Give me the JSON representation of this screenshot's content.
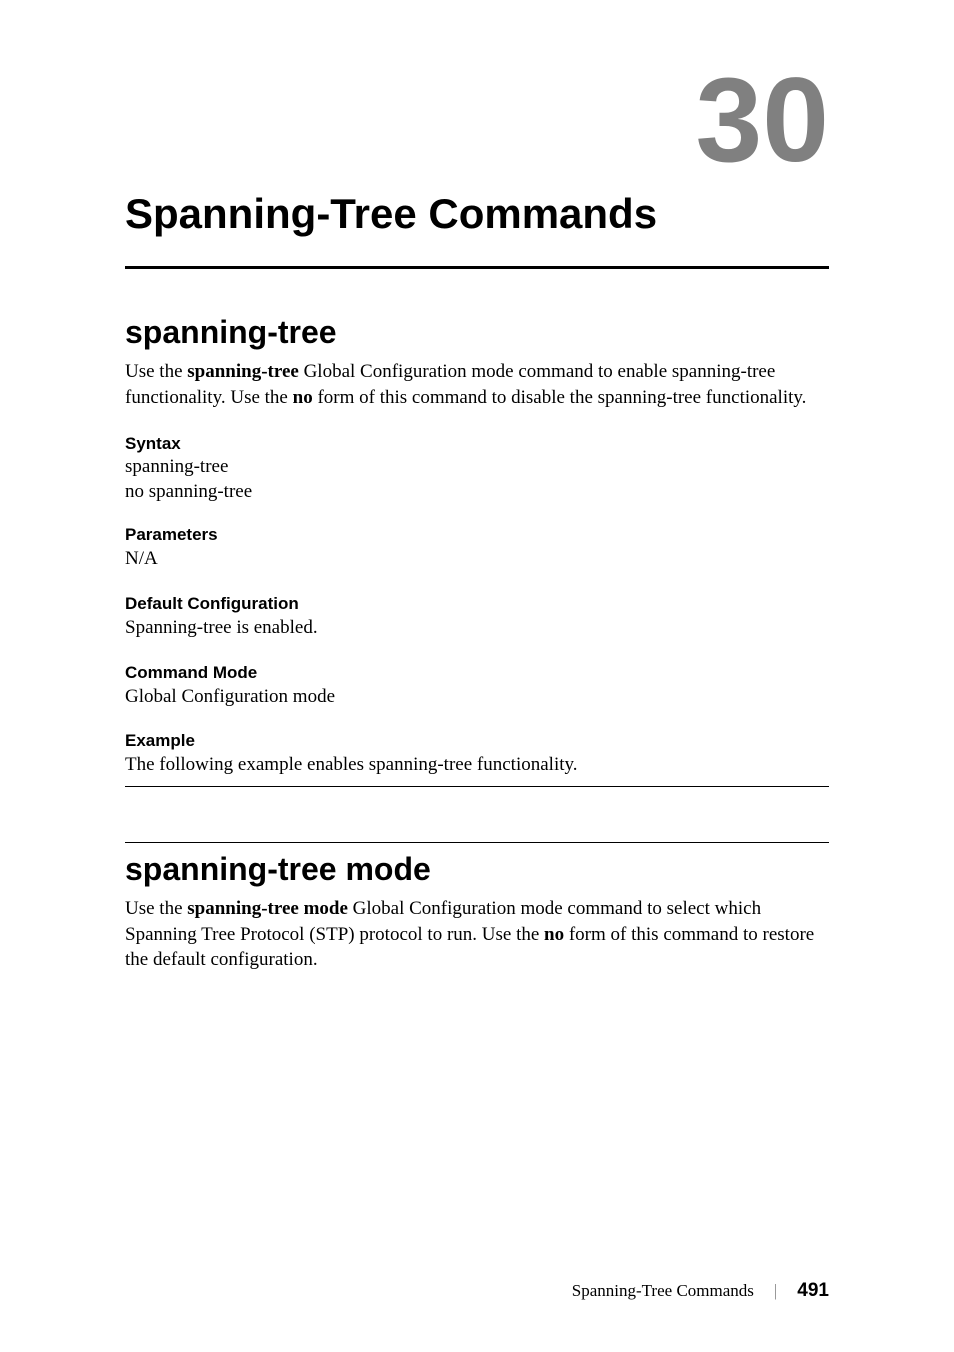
{
  "chapter_number": "30",
  "chapter_title": "Spanning-Tree Commands",
  "section1": {
    "title": "spanning-tree",
    "intro_pre": "Use the ",
    "intro_bold1": "spanning-tree",
    "intro_mid": " Global Configuration mode command to enable spanning-tree functionality. Use the ",
    "intro_bold2": "no",
    "intro_post": " form of this command to disable the spanning-tree functionality.",
    "syntax_heading": "Syntax",
    "syntax_line1": "spanning-tree",
    "syntax_line2": "no spanning-tree",
    "parameters_heading": "Parameters",
    "parameters_text": "N/A",
    "default_heading": "Default Configuration",
    "default_text": "Spanning-tree is enabled.",
    "mode_heading": "Command Mode",
    "mode_text": "Global Configuration mode",
    "example_heading": "Example",
    "example_text": "The following example enables spanning-tree functionality."
  },
  "section2": {
    "title": "spanning-tree mode",
    "intro_pre": "Use the ",
    "intro_bold1": "spanning-tree mode",
    "intro_mid": " Global Configuration mode command to select which Spanning Tree Protocol (STP) protocol to run. Use the ",
    "intro_bold2": "no",
    "intro_post": " form of this command to restore the default configuration."
  },
  "footer": {
    "section": "Spanning-Tree Commands",
    "divider": "|",
    "page": "491"
  }
}
